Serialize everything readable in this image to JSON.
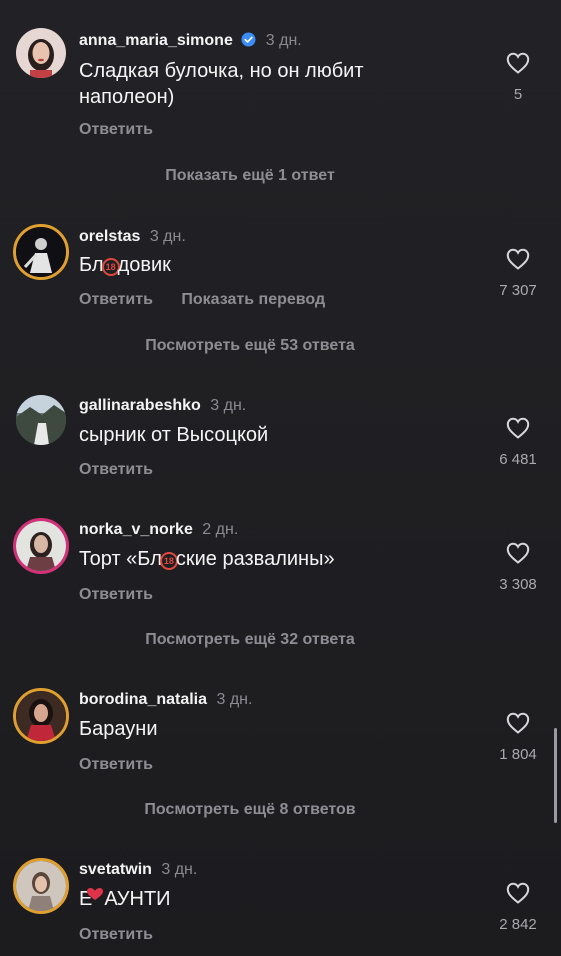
{
  "comments": [
    {
      "username": "anna_maria_simone",
      "verified": true,
      "time": "3 дн.",
      "text": "Сладкая булочка, но он любит наполеон)",
      "reply": "Ответить",
      "likes": "5"
    },
    {
      "username": "orelstas",
      "time": "3 дн.",
      "text_pre": "Бл",
      "text_post": "довик",
      "censor_mark": "18",
      "reply": "Ответить",
      "translate": "Показать перевод",
      "likes": "7 307"
    },
    {
      "username": "gallinarabeshko",
      "time": "3 дн.",
      "text": "сырник от Высоцкой",
      "reply": "Ответить",
      "likes": "6 481"
    },
    {
      "username": "norka_v_norke",
      "time": "2 дн.",
      "text_pre": "Торт «Бл",
      "text_post": "ские развалины»",
      "censor_mark": "18",
      "reply": "Ответить",
      "likes": "3 308"
    },
    {
      "username": "borodina_natalia",
      "time": "3 дн.",
      "text": "Барауни",
      "reply": "Ответить",
      "likes": "1 804"
    },
    {
      "username": "svetatwin",
      "time": "3 дн.",
      "text_pre": "Е",
      "text_post": "АУНТИ",
      "reply": "Ответить",
      "likes": "2 842"
    }
  ],
  "more_links": {
    "anna": "Показать ещё 1 ответ",
    "orelstas": "Посмотреть ещё 53 ответа",
    "norka": "Посмотреть ещё 32 ответа",
    "borodina": "Посмотреть ещё 8 ответов"
  },
  "icons": {
    "like": "heart-outline-icon",
    "verified": "verified-badge-icon",
    "censor": "age-18-censor-icon"
  },
  "colors": {
    "background": "#1f1f22",
    "accent_verified": "#3b8cf5",
    "muted": "#8d8d93",
    "censor": "#e0483c"
  }
}
